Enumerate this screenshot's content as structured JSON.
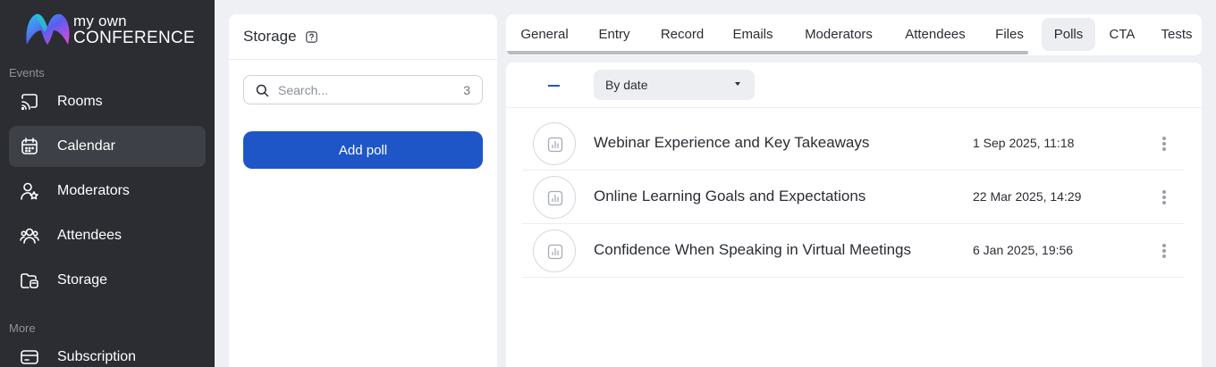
{
  "brand": {
    "line1": "my own",
    "line2": "CONFERENCE"
  },
  "sidebar": {
    "sections": [
      {
        "label": "Events"
      },
      {
        "label": "More"
      }
    ],
    "items": [
      {
        "label": "Rooms",
        "icon": "cast-icon"
      },
      {
        "label": "Calendar",
        "icon": "calendar-icon",
        "active": true
      },
      {
        "label": "Moderators",
        "icon": "user-star-icon"
      },
      {
        "label": "Attendees",
        "icon": "users-icon"
      },
      {
        "label": "Storage",
        "icon": "folder-icon"
      },
      {
        "label": "Subscription",
        "icon": "card-icon"
      }
    ]
  },
  "storage": {
    "title": "Storage",
    "search_placeholder": "Search...",
    "count": "3",
    "add_label": "Add poll"
  },
  "tabs": [
    {
      "label": "General"
    },
    {
      "label": "Entry"
    },
    {
      "label": "Record"
    },
    {
      "label": "Emails"
    },
    {
      "label": "Moderators"
    },
    {
      "label": "Attendees"
    },
    {
      "label": "Files"
    },
    {
      "label": "Polls",
      "active": true
    },
    {
      "label": "CTA"
    },
    {
      "label": "Tests"
    }
  ],
  "toolbar": {
    "sort_label": "By date"
  },
  "polls": [
    {
      "title": "Webinar Experience and Key Takeaways",
      "date": "1 Sep 2025, 11:18"
    },
    {
      "title": "Online Learning Goals and Expectations",
      "date": "22 Mar 2025, 14:29"
    },
    {
      "title": "Confidence When Speaking in Virtual Meetings",
      "date": "6 Jan 2025, 19:56"
    }
  ],
  "colors": {
    "sidebar": "#2b2d33",
    "accent": "#1e56c7",
    "active_nav": "#3d4047"
  }
}
